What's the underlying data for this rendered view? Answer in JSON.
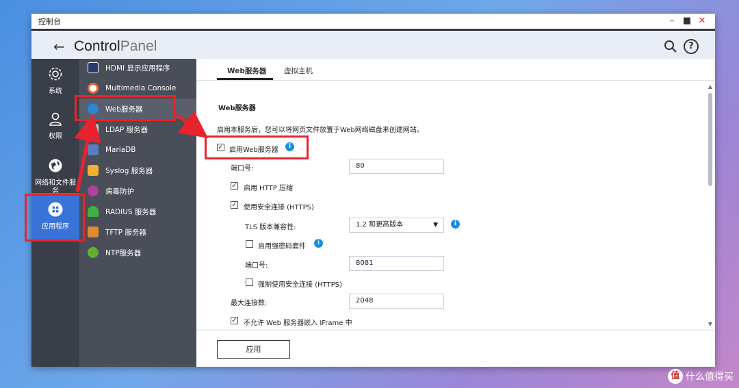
{
  "window": {
    "title": "控制台",
    "controls": [
      "–",
      "■",
      "✕"
    ]
  },
  "header": {
    "brand_bold": "Control",
    "brand_thin": "Panel"
  },
  "leftnav": [
    {
      "label": "系统",
      "icon": "gear-icon"
    },
    {
      "label": "权限",
      "icon": "user-icon"
    },
    {
      "label": "网络和文件服务",
      "icon": "globe-icon"
    },
    {
      "label": "应用程序",
      "icon": "apps-grid-icon",
      "active": true
    }
  ],
  "subnav": [
    {
      "label": "HDMI 显示应用程序",
      "icon": "hdmi-icon",
      "color": "#2b3a6b"
    },
    {
      "label": "Multimedia Console",
      "icon": "multimedia-icon",
      "color": "#e86b3a"
    },
    {
      "label": "Web服务器",
      "icon": "web-icon",
      "color": "#2a86d8",
      "active": true
    },
    {
      "label": "LDAP 服务器",
      "icon": "ldap-icon",
      "color": "#2b3a6b"
    },
    {
      "label": "MariaDB",
      "icon": "database-icon",
      "color": "#5a7fc0"
    },
    {
      "label": "Syslog 服务器",
      "icon": "syslog-icon",
      "color": "#f0b030"
    },
    {
      "label": "病毒防护",
      "icon": "virus-icon",
      "color": "#b040a0"
    },
    {
      "label": "RADIUS 服务器",
      "icon": "radius-icon",
      "color": "#40b040"
    },
    {
      "label": "TFTP 服务器",
      "icon": "tftp-icon",
      "color": "#e08a30"
    },
    {
      "label": "NTP服务器",
      "icon": "ntp-icon",
      "color": "#60b030"
    }
  ],
  "tabs": [
    {
      "label": "Web服务器",
      "active": true
    },
    {
      "label": "虚拟主机"
    }
  ],
  "form": {
    "section_title": "Web服务器",
    "description": "启用本服务后，您可以将网页文件放置于Web网络磁盘来创建网站。",
    "enable_web": {
      "label": "启用Web服务器",
      "checked": true
    },
    "port_label": "端口号:",
    "port_value": "80",
    "http_compress": {
      "label": "启用 HTTP 压缩",
      "checked": true
    },
    "https": {
      "label": "使用安全连接 (HTTPS)",
      "checked": true
    },
    "tls_label": "TLS 版本兼容性:",
    "tls_value": "1.2 和更高版本",
    "strong_cipher": {
      "label": "启用强密码套件",
      "checked": false
    },
    "https_port_label": "端口号:",
    "https_port_value": "8081",
    "force_https": {
      "label": "强制使用安全连接 (HTTPS)",
      "checked": false
    },
    "max_conn_label": "最大连接数:",
    "max_conn_value": "2048",
    "iframe": {
      "label": "不允许 Web 服务器嵌入 IFrame 中",
      "checked": true
    }
  },
  "footer": {
    "apply_label": "应用"
  },
  "watermark": {
    "badge": "值",
    "text": "什么值得买"
  },
  "colors": {
    "accent": "#3a73d8",
    "highlight": "#e8232e",
    "info": "#1a8fe0"
  }
}
